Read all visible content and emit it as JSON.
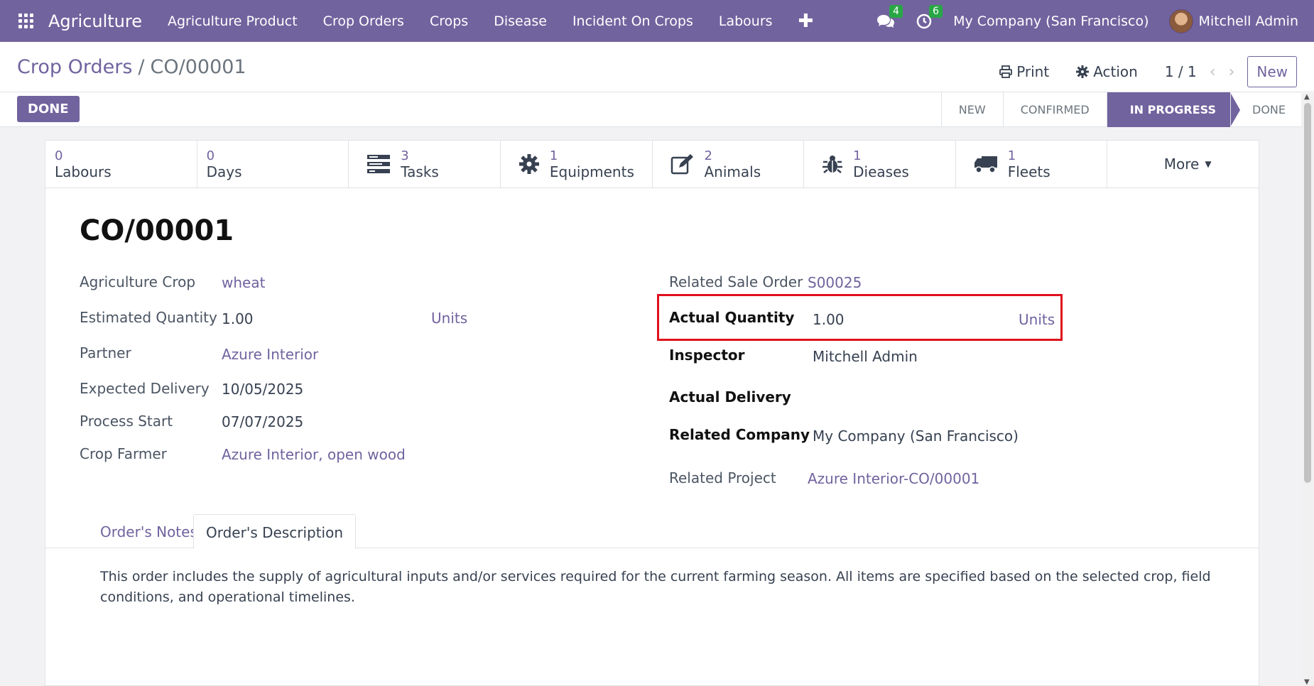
{
  "navbar": {
    "brand": "Agriculture",
    "menu": [
      "Agriculture Product",
      "Crop Orders",
      "Crops",
      "Disease",
      "Incident On Crops",
      "Labours"
    ],
    "plus": "✚",
    "messages_count": "4",
    "activities_count": "6",
    "company": "My Company (San Francisco)",
    "user": "Mitchell Admin"
  },
  "control_panel": {
    "breadcrumb_parent": "Crop Orders",
    "breadcrumb_sep": "/",
    "breadcrumb_current": "CO/00001",
    "print_label": "Print",
    "action_label": "Action",
    "pager": "1 / 1",
    "pager_prev": "‹",
    "pager_next": "›",
    "new_label": "New",
    "done_button": "DONE"
  },
  "statusbar": {
    "stages": [
      "NEW",
      "CONFIRMED",
      "IN PROGRESS",
      "DONE"
    ],
    "active": "IN PROGRESS"
  },
  "stat_buttons": [
    {
      "value": "0",
      "label": "Labours",
      "icon": ""
    },
    {
      "value": "0",
      "label": "Days",
      "icon": ""
    },
    {
      "value": "3",
      "label": "Tasks",
      "icon": "tasks-icon"
    },
    {
      "value": "1",
      "label": "Equipments",
      "icon": "gear-icon"
    },
    {
      "value": "2",
      "label": "Animals",
      "icon": "edit-icon"
    },
    {
      "value": "1",
      "label": "Dieases",
      "icon": "bug-icon"
    },
    {
      "value": "1",
      "label": "Fleets",
      "icon": "truck-icon"
    }
  ],
  "more_label": "More",
  "record": {
    "title": "CO/00001",
    "left_fields": {
      "agriculture_crop": {
        "label": "Agriculture Crop",
        "value": "wheat"
      },
      "estimated_quantity": {
        "label": "Estimated Quantity",
        "value": "1.00",
        "unit": "Units"
      },
      "partner": {
        "label": "Partner",
        "value": "Azure Interior"
      },
      "expected_delivery": {
        "label": "Expected Delivery",
        "value": "10/05/2025"
      },
      "process_start": {
        "label": "Process Start",
        "value": "07/07/2025"
      },
      "crop_farmer": {
        "label": "Crop Farmer",
        "value": "Azure Interior, open wood"
      }
    },
    "right_fields": {
      "related_sale_order": {
        "label": "Related Sale Order",
        "value": "S00025"
      },
      "actual_quantity": {
        "label": "Actual Quantity",
        "value": "1.00",
        "unit": "Units"
      },
      "inspector": {
        "label": "Inspector",
        "value": "Mitchell Admin"
      },
      "actual_delivery": {
        "label": "Actual Delivery",
        "value": ""
      },
      "related_company": {
        "label": "Related Company",
        "value": "My Company (San Francisco)"
      },
      "related_project": {
        "label": "Related Project",
        "value": "Azure Interior-CO/00001"
      }
    }
  },
  "tabs": {
    "notes": "Order's Notes",
    "description": "Order's Description",
    "active": "Order's Description"
  },
  "description_text": "This order includes the supply of agricultural inputs and/or services required for the current farming season. All items are specified based on the selected crop, field conditions, and operational timelines.",
  "colors": {
    "brand": "#71639e",
    "badge": "#28a745",
    "highlight": "#e0121c"
  }
}
